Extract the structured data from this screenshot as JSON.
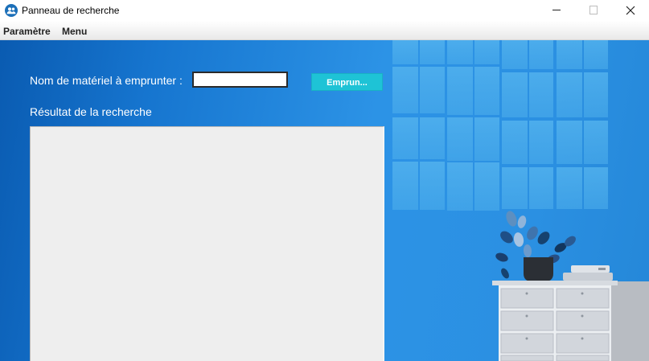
{
  "window": {
    "title": "Panneau de recherche",
    "icon": "users-icon",
    "controls": [
      "minimize-icon",
      "maximize-icon",
      "close-icon"
    ]
  },
  "menubar": {
    "items": [
      {
        "label": "Paramètre"
      },
      {
        "label": "Menu"
      }
    ]
  },
  "form": {
    "material_label": "Nom de matériel à emprunter :",
    "material_value": "",
    "borrow_button": "Emprun...",
    "result_label": "Résultat de la recherche",
    "result_value": ""
  },
  "colors": {
    "background_blue": "#2c93e6",
    "button_cyan": "#1ec3d6",
    "result_area": "#eeeeee"
  }
}
